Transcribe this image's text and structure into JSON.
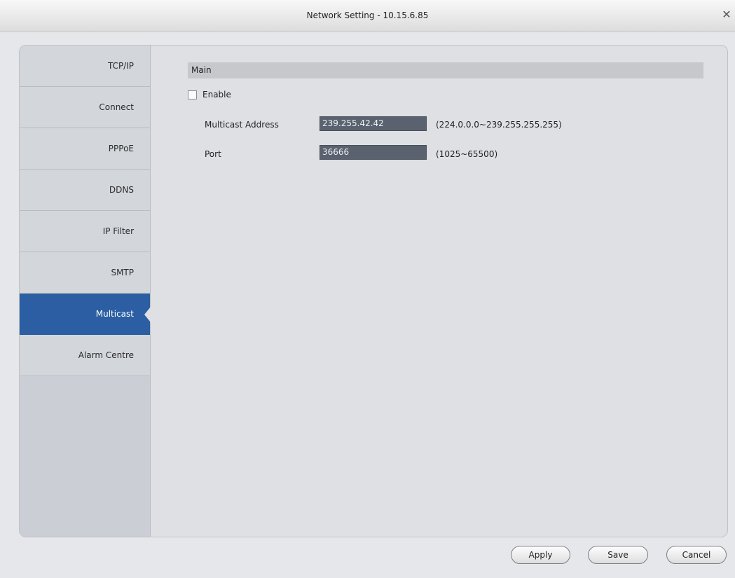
{
  "window": {
    "title": "Network Setting - 10.15.6.85"
  },
  "sidebar": {
    "items": [
      {
        "label": "TCP/IP"
      },
      {
        "label": "Connect"
      },
      {
        "label": "PPPoE"
      },
      {
        "label": "DDNS"
      },
      {
        "label": "IP Filter"
      },
      {
        "label": "SMTP"
      },
      {
        "label": "Multicast",
        "active": true
      },
      {
        "label": "Alarm Centre"
      }
    ]
  },
  "main": {
    "section_title": "Main",
    "enable_label": "Enable",
    "enable_checked": false,
    "multicast_address": {
      "label": "Multicast Address",
      "value": "239.255.42.42",
      "range": "(224.0.0.0~239.255.255.255)"
    },
    "port": {
      "label": "Port",
      "value": "36666",
      "range": "(1025~65500)"
    }
  },
  "footer": {
    "apply_label": "Apply",
    "save_label": "Save",
    "cancel_label": "Cancel"
  },
  "colors": {
    "active_nav": "#2b5ea2",
    "input_bg": "#5a6270"
  },
  "icons": {
    "close": "close-icon"
  }
}
